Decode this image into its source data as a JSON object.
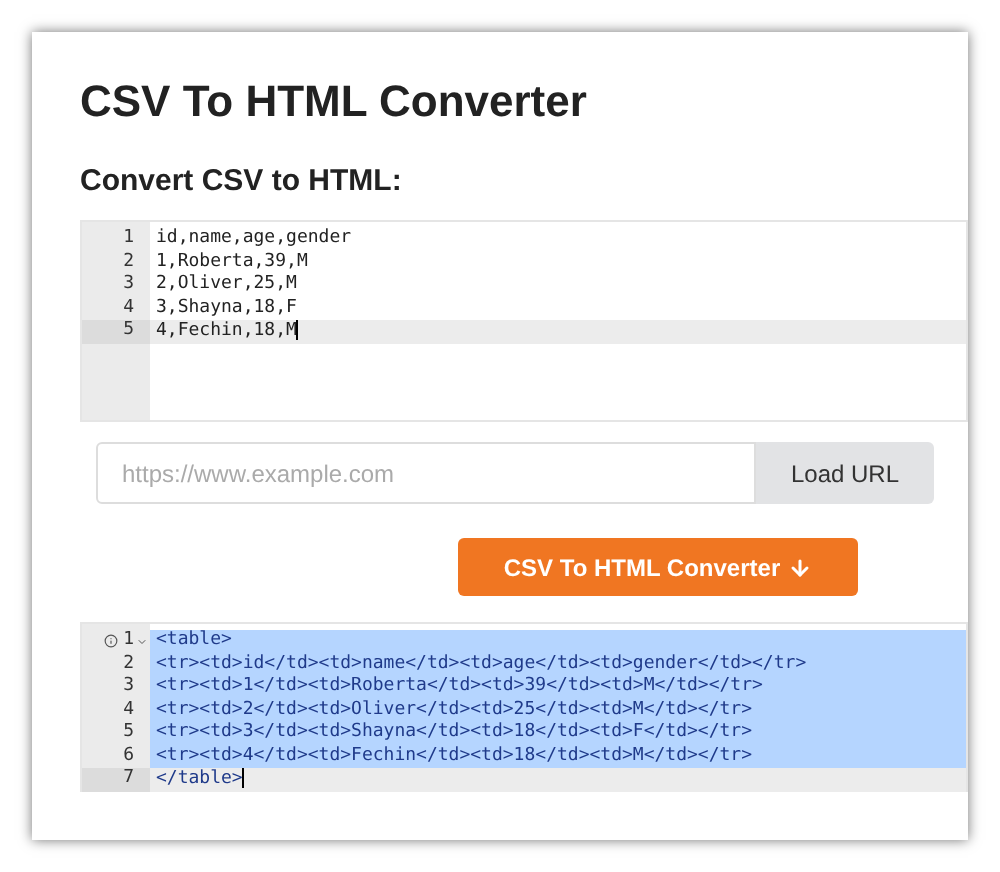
{
  "title": "CSV To HTML Converter",
  "subtitle": "Convert CSV to HTML:",
  "input_editor": {
    "lines": [
      {
        "number": "1",
        "text": "id,name,age,gender",
        "active": false
      },
      {
        "number": "2",
        "text": "1,Roberta,39,M",
        "active": false
      },
      {
        "number": "3",
        "text": "2,Oliver,25,M",
        "active": false
      },
      {
        "number": "4",
        "text": "3,Shayna,18,F",
        "active": false
      },
      {
        "number": "5",
        "text": "4,Fechin,18,M",
        "active": true
      }
    ]
  },
  "url_field": {
    "placeholder": "https://www.example.com"
  },
  "load_button": "Load URL",
  "convert_button": "CSV To HTML Converter",
  "output_editor": {
    "lines": [
      {
        "number": "1",
        "text": "<table>",
        "active": false,
        "selected": true
      },
      {
        "number": "2",
        "text": "<tr><td>id</td><td>name</td><td>age</td><td>gender</td></tr>",
        "active": false,
        "selected": true
      },
      {
        "number": "3",
        "text": "<tr><td>1</td><td>Roberta</td><td>39</td><td>M</td></tr>",
        "active": false,
        "selected": true
      },
      {
        "number": "4",
        "text": "<tr><td>2</td><td>Oliver</td><td>25</td><td>M</td></tr>",
        "active": false,
        "selected": true
      },
      {
        "number": "5",
        "text": "<tr><td>3</td><td>Shayna</td><td>18</td><td>F</td></tr>",
        "active": false,
        "selected": true
      },
      {
        "number": "6",
        "text": "<tr><td>4</td><td>Fechin</td><td>18</td><td>M</td></tr>",
        "active": false,
        "selected": true
      },
      {
        "number": "7",
        "text": "</table>",
        "active": true,
        "selected": false
      }
    ]
  }
}
